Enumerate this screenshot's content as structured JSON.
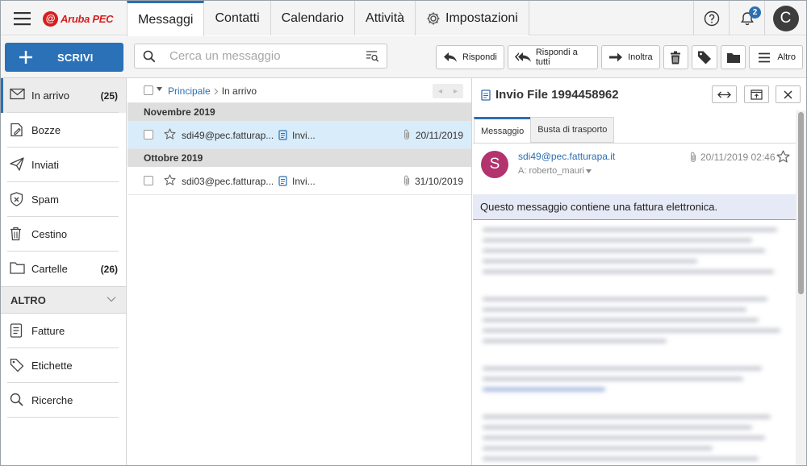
{
  "app": {
    "brand": "Aruba PEC",
    "logo_letter": "@"
  },
  "nav_tabs": [
    "Messaggi",
    "Contatti",
    "Calendario",
    "Attività",
    "Impostazioni"
  ],
  "top_right": {
    "notifications": "2",
    "avatar": "C"
  },
  "toolbar": {
    "compose_label": "SCRIVI",
    "search_placeholder": "Cerca un messaggio",
    "reply": "Rispondi",
    "reply_all": "Rispondi a tutti",
    "forward": "Inoltra",
    "more": "Altro"
  },
  "sidebar": {
    "items": [
      {
        "label": "In arrivo",
        "count": "(25)"
      },
      {
        "label": "Bozze",
        "count": ""
      },
      {
        "label": "Inviati",
        "count": ""
      },
      {
        "label": "Spam",
        "count": ""
      },
      {
        "label": "Cestino",
        "count": ""
      },
      {
        "label": "Cartelle",
        "count": "(26)"
      }
    ],
    "section": "ALTRO",
    "extra": [
      {
        "label": "Fatture"
      },
      {
        "label": "Etichette"
      },
      {
        "label": "Ricerche"
      }
    ]
  },
  "list": {
    "breadcrumb": {
      "root": "Principale",
      "current": "In arrivo"
    },
    "groups": [
      {
        "title": "Novembre 2019",
        "rows": [
          {
            "from": "sdi49@pec.fatturap...",
            "subject": "Invi...",
            "date": "20/11/2019"
          }
        ]
      },
      {
        "title": "Ottobre 2019",
        "rows": [
          {
            "from": "sdi03@pec.fatturap...",
            "subject": "Invi...",
            "date": "31/10/2019"
          }
        ]
      }
    ]
  },
  "message": {
    "title": "Invio File 1994458962",
    "tabs": [
      "Messaggio",
      "Busta di trasporto"
    ],
    "avatar": "S",
    "sender": "sdi49@pec.fatturapa.it",
    "recipient": "A: roberto_mauri",
    "date": "20/11/2019 02:46",
    "notice": "Questo messaggio contiene una fattura elettronica."
  },
  "colors": {
    "accent": "#2c6fb1",
    "brand": "#d81e1e",
    "annotation_arrow": "#d32626"
  }
}
